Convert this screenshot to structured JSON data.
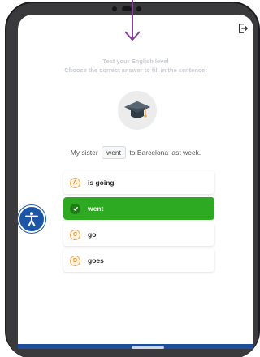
{
  "quiz": {
    "heading_line1": "Test your English level",
    "heading_line2": "Choose the correct answer to fill in the sentence:",
    "sentence_before": "My sister",
    "sentence_blank": "went",
    "sentence_after": "to Barcelona last week.",
    "options": [
      {
        "letter": "A",
        "label": "is going",
        "selected": false
      },
      {
        "letter": "",
        "label": "went",
        "selected": true
      },
      {
        "letter": "C",
        "label": "go",
        "selected": false
      },
      {
        "letter": "D",
        "label": "goes",
        "selected": false
      }
    ]
  },
  "icons": {
    "top": "down-arrow-icon",
    "header": "logout-icon",
    "hero": "graduation-cap-icon",
    "selected_option": "checkmark-icon",
    "floating": "accessibility-icon"
  },
  "colors": {
    "selected": "#2eaa22",
    "letter_badge": "#e8922f",
    "accessibility": "#1c56a6",
    "arrow": "#8a3fa0"
  }
}
